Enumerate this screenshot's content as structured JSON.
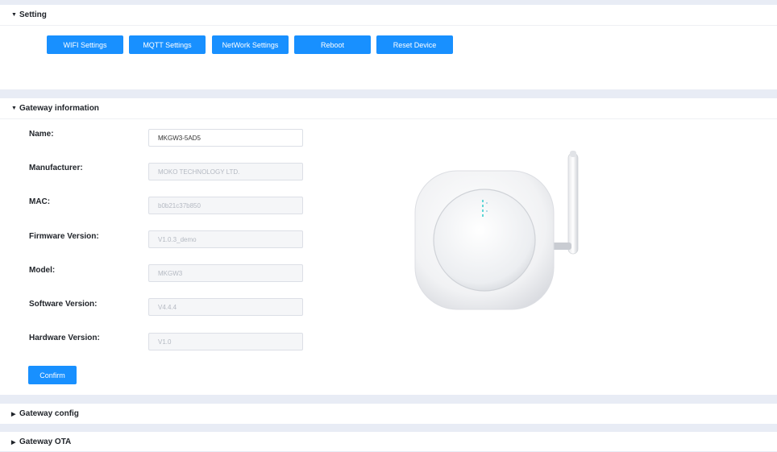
{
  "setting": {
    "title": "Setting",
    "buttons": [
      "WIFI Settings",
      "MQTT Settings",
      "NetWork Settings",
      "Reboot",
      "Reset Device"
    ]
  },
  "gateway_info": {
    "title": "Gateway information",
    "fields": [
      {
        "label": "Name:",
        "value": "MKGW3-5AD5",
        "editable": true
      },
      {
        "label": "Manufacturer:",
        "value": "MOKO TECHNOLOGY LTD.",
        "editable": false
      },
      {
        "label": "MAC:",
        "value": "b0b21c37b850",
        "editable": false
      },
      {
        "label": "Firmware Version:",
        "value": "V1.0.3_demo",
        "editable": false
      },
      {
        "label": "Model:",
        "value": "MKGW3",
        "editable": false
      },
      {
        "label": "Software Version:",
        "value": "V4.4.4",
        "editable": false
      },
      {
        "label": "Hardware Version:",
        "value": "V1.0",
        "editable": false
      }
    ],
    "confirm_label": "Confirm"
  },
  "gateway_config": {
    "title": "Gateway config"
  },
  "gateway_ota": {
    "title": "Gateway OTA"
  },
  "icons": {
    "expanded": "caret-down-icon",
    "collapsed": "caret-right-icon"
  },
  "colors": {
    "accent": "#1890ff",
    "page_bg": "#e8ecf5",
    "led": "#5fd6d6"
  }
}
